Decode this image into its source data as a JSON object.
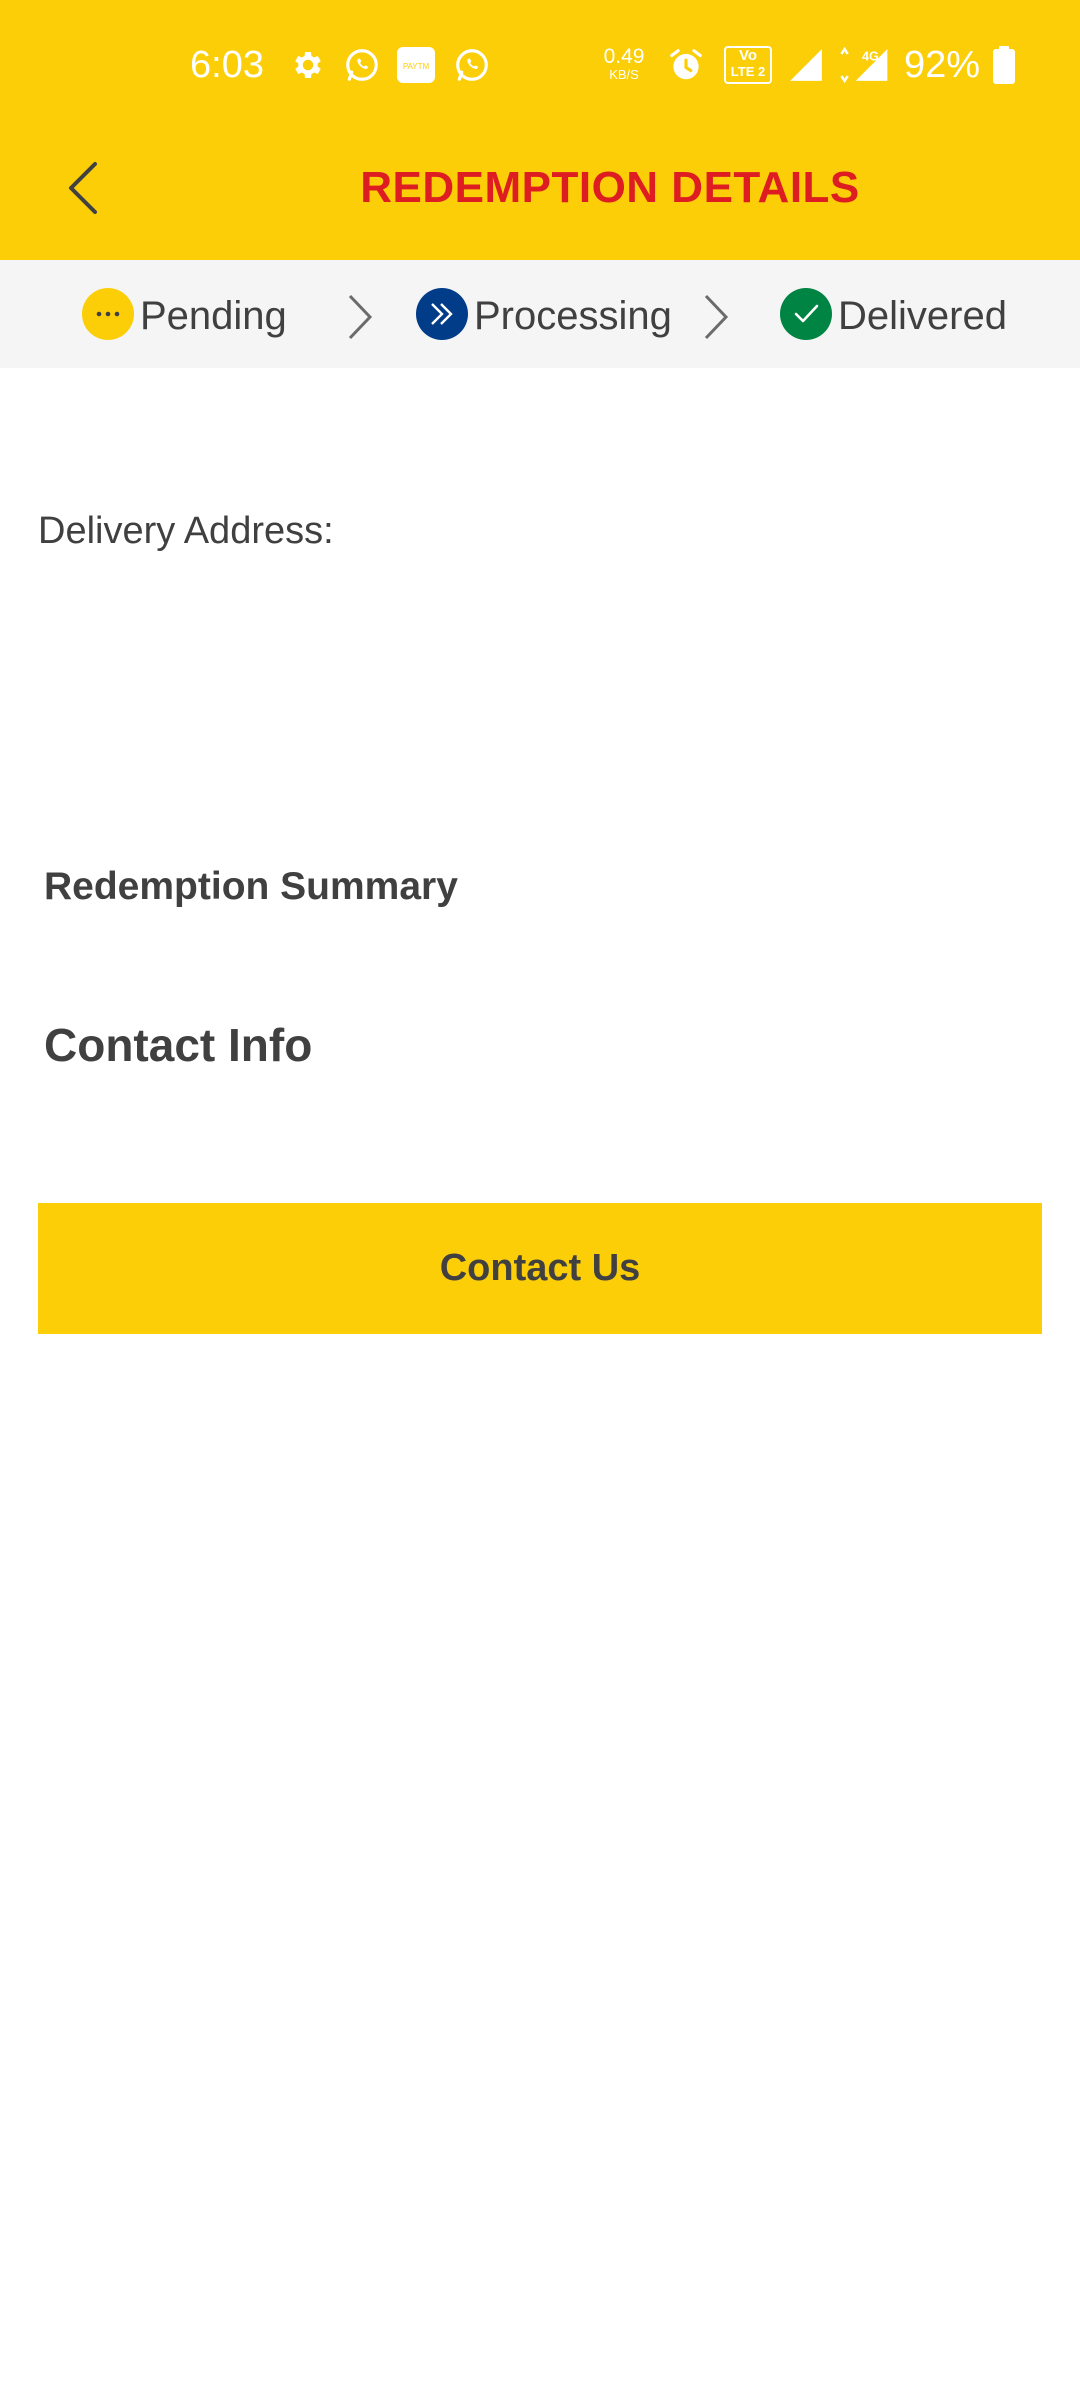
{
  "status_bar": {
    "time": "6:03",
    "net_speed_value": "0.49",
    "net_speed_unit": "KB/S",
    "volte_line1": "Vo",
    "volte_line2": "LTE 2",
    "network": "4G",
    "battery": "92%",
    "app_badge": "PAYTM",
    "icons": [
      "gear-icon",
      "whatsapp-icon",
      "paytm-icon",
      "whatsapp-icon",
      "alarm-icon",
      "volte-icon",
      "signal-icon",
      "signal-4g-icon",
      "battery-icon"
    ]
  },
  "header": {
    "title": "REDEMPTION DETAILS",
    "title_color": "#DD1D21",
    "background": "#FBCE07"
  },
  "steps": [
    {
      "label": "Pending",
      "icon": "ellipsis-icon",
      "color": "#FBCE07"
    },
    {
      "label": "Processing",
      "icon": "double-chevron-icon",
      "color": "#003C88"
    },
    {
      "label": "Delivered",
      "icon": "check-icon",
      "color": "#008443"
    }
  ],
  "content": {
    "delivery_label": "Delivery Address:",
    "summary_title": "Redemption Summary",
    "contact_title": "Contact Info"
  },
  "actions": {
    "contact_label": "Contact Us"
  }
}
